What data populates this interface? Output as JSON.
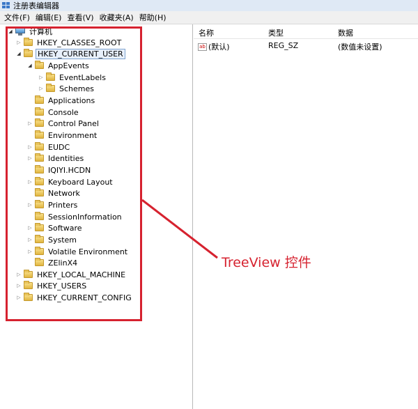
{
  "window": {
    "title": "注册表编辑器"
  },
  "menubar": [
    "文件(F)",
    "编辑(E)",
    "查看(V)",
    "收藏夹(A)",
    "帮助(H)"
  ],
  "tree": {
    "root": "计算机",
    "hives": [
      "HKEY_CLASSES_ROOT",
      "HKEY_CURRENT_USER",
      "HKEY_LOCAL_MACHINE",
      "HKEY_USERS",
      "HKEY_CURRENT_CONFIG"
    ],
    "current_user_children": [
      "AppEvents",
      "Applications",
      "Console",
      "Control Panel",
      "Environment",
      "EUDC",
      "Identities",
      "IQIYI.HCDN",
      "Keyboard Layout",
      "Network",
      "Printers",
      "SessionInformation",
      "Software",
      "System",
      "Volatile Environment",
      "ZElinX4"
    ],
    "appevents_children": [
      "EventLabels",
      "Schemes"
    ]
  },
  "list": {
    "columns": [
      "名称",
      "类型",
      "数据"
    ],
    "rows": [
      {
        "name": "(默认)",
        "type": "REG_SZ",
        "data": "(数值未设置)",
        "icon": "ab-string-icon"
      }
    ]
  },
  "annotation": {
    "text": "TreeView 控件",
    "color": "#d6222f"
  },
  "colors": {
    "highlight": "#d6222f",
    "selection_border": "#7da2ce",
    "folder": "#e8c35a"
  }
}
